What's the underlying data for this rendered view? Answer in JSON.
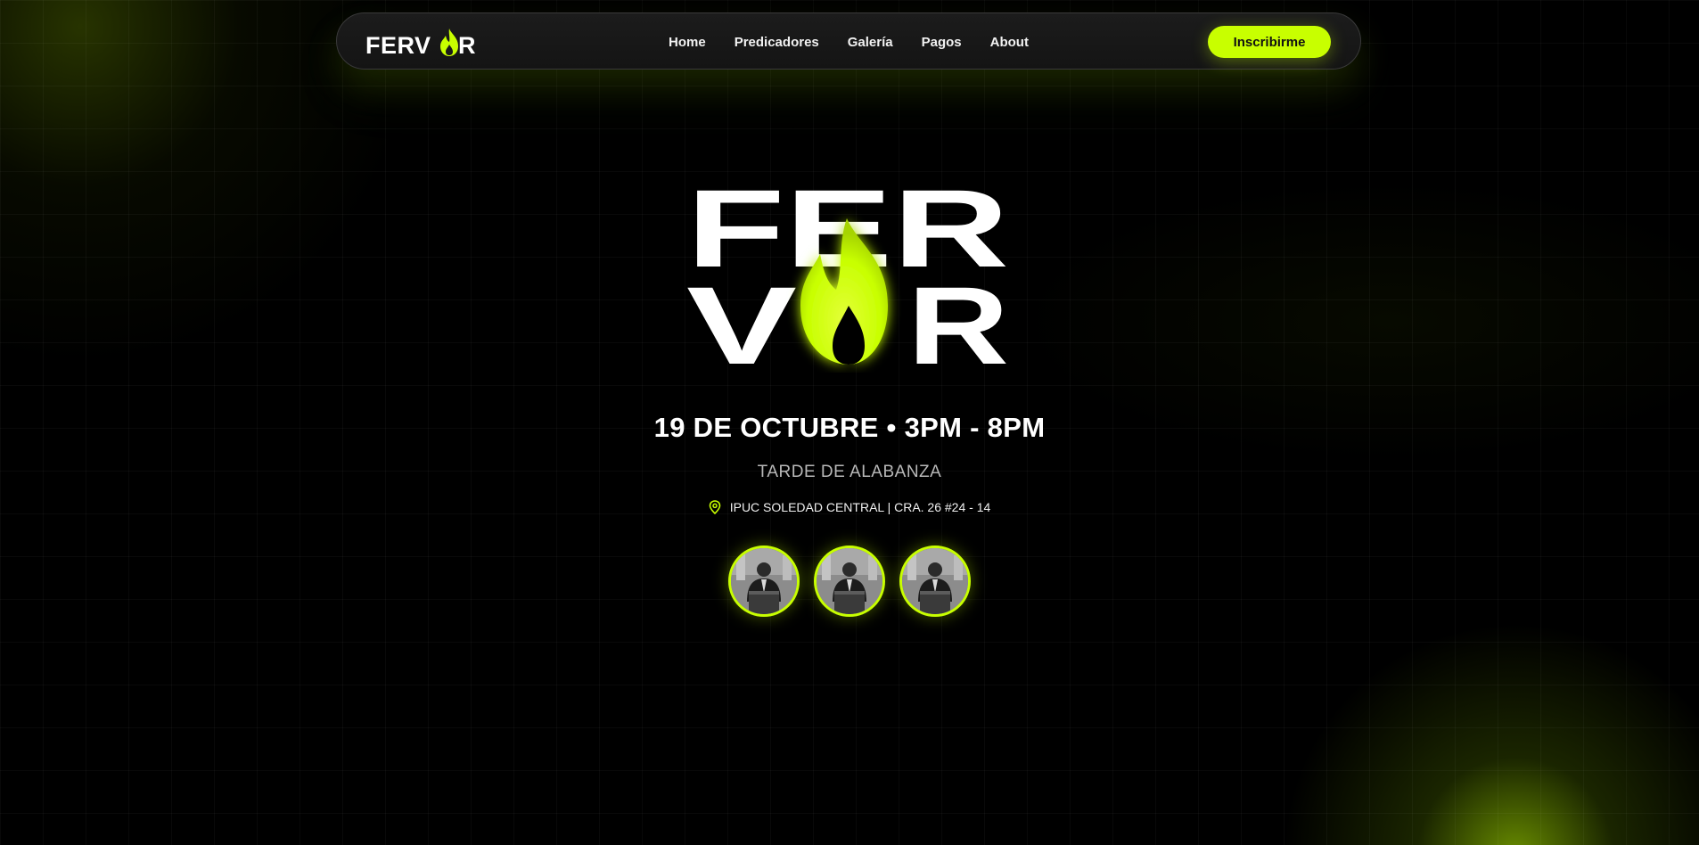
{
  "brand": {
    "name": "FERVOR",
    "accent_color": "#c8ff00",
    "logo_icon": "flame-icon"
  },
  "nav": {
    "links": [
      {
        "label": "Home"
      },
      {
        "label": "Predicadores"
      },
      {
        "label": "Galería"
      },
      {
        "label": "Pagos"
      },
      {
        "label": "About"
      }
    ],
    "cta_label": "Inscribirme"
  },
  "hero": {
    "date_line": "19 DE OCTUBRE • 3PM - 8PM",
    "subtitle": "TARDE DE ALABANZA",
    "location": "IPUC SOLEDAD CENTRAL | CRA. 26 #24 - 14",
    "location_icon": "map-pin-icon",
    "speakers": [
      {
        "icon": "speaker-photo"
      },
      {
        "icon": "speaker-photo"
      },
      {
        "icon": "speaker-photo"
      }
    ]
  }
}
